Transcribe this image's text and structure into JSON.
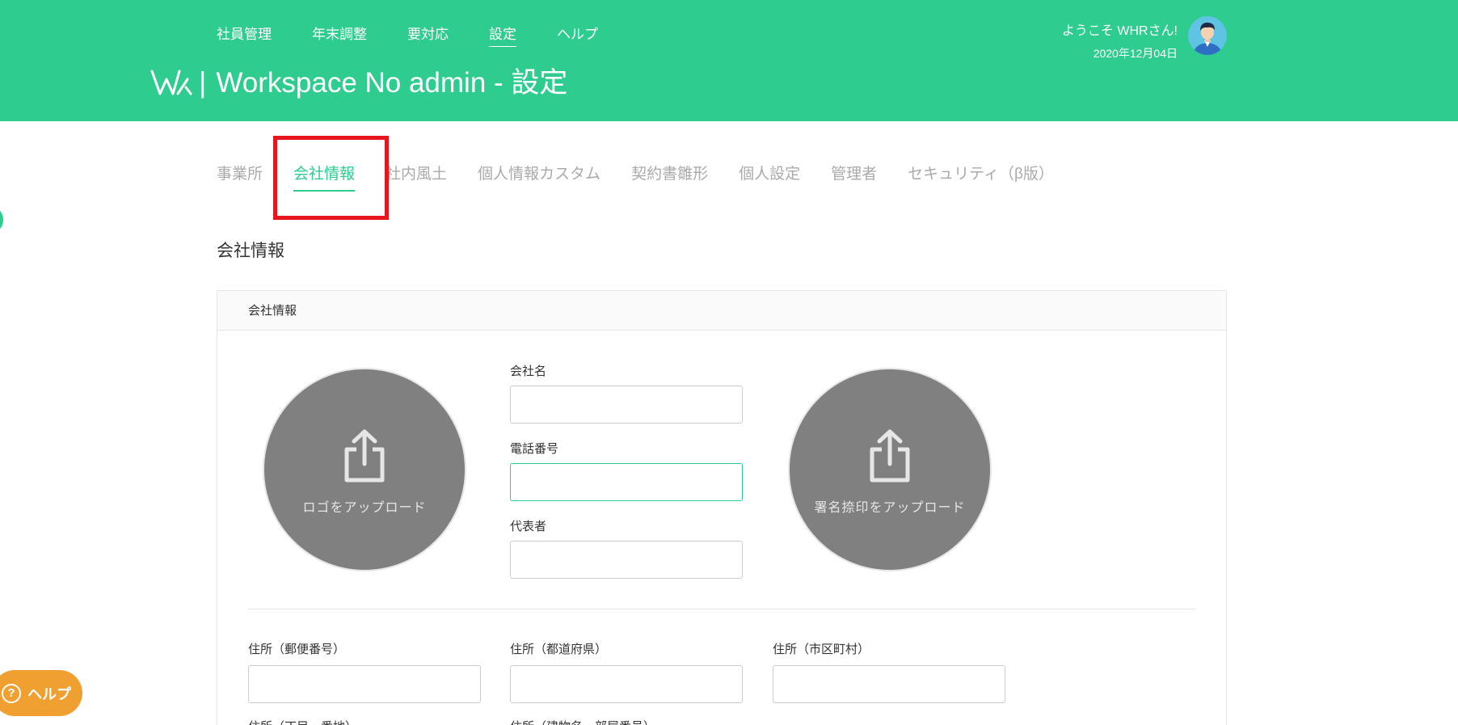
{
  "header": {
    "nav": [
      "社員管理",
      "年末調整",
      "要対応",
      "設定",
      "ヘルプ"
    ],
    "active_nav": 3,
    "logo_separator": "|",
    "title": "Workspace No admin - 設定",
    "welcome": "ようこそ WHRさん!",
    "date": "2020年12月04日",
    "icons": {
      "logo": "workvision-logo-icon",
      "avatar": "user-avatar-icon"
    }
  },
  "tabs": {
    "items": [
      "事業所",
      "会社情報",
      "社内風土",
      "個人情報カスタム",
      "契約書雛形",
      "個人設定",
      "管理者",
      "セキュリティ（β版）"
    ],
    "active": 1
  },
  "section_title": "会社情報",
  "card": {
    "header": "会社情報",
    "upload_logo_label": "ロゴをアップロード",
    "upload_stamp_label": "署名捺印をアップロード",
    "fields": {
      "company_name": {
        "label": "会社名",
        "value": ""
      },
      "phone": {
        "label": "電話番号",
        "value": ""
      },
      "representative": {
        "label": "代表者",
        "value": ""
      },
      "postal_code": {
        "label": "住所（郵便番号）",
        "value": ""
      },
      "prefecture": {
        "label": "住所（都道府県）",
        "value": ""
      },
      "city": {
        "label": "住所（市区町村）",
        "value": ""
      },
      "street": {
        "label": "住所（丁目・番地）"
      },
      "building": {
        "label": "住所（建物名・部屋番号）"
      }
    }
  },
  "help_button": {
    "label": "ヘルプ",
    "icon": "question-circle-icon"
  },
  "colors": {
    "brand": "#2ecc8f",
    "highlight": "#e8141e",
    "help": "#f0a030",
    "upload": "#808080"
  }
}
